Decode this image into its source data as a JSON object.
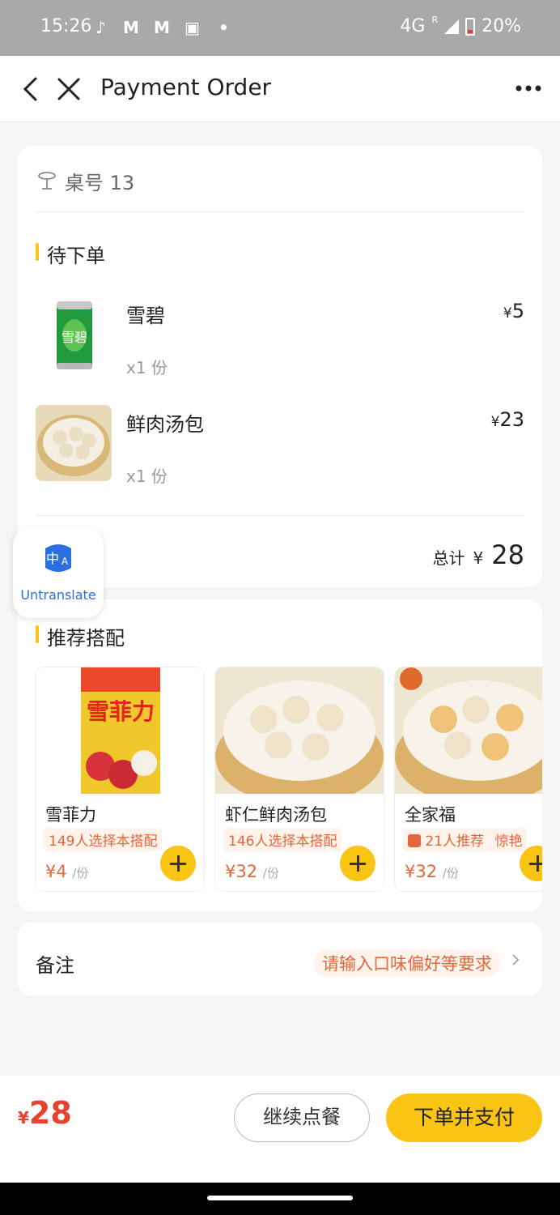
{
  "status_bar": {
    "time": "15:26",
    "network": "4G",
    "roaming": "R",
    "battery": "20%",
    "notification_icons": [
      "tiktok-icon",
      "gmail-icon",
      "gmail-icon",
      "cast-icon",
      "dot-icon"
    ]
  },
  "nav": {
    "title": "Payment Order"
  },
  "order": {
    "table_label": "桌号 13",
    "pending_title": "待下单",
    "currency": "¥",
    "items": [
      {
        "name": "雪碧",
        "qty": "x1 份",
        "price": "5"
      },
      {
        "name": "鲜肉汤包",
        "qty": "x1 份",
        "price": "23"
      }
    ],
    "total_label": "总计",
    "total_value": "28"
  },
  "recommend": {
    "title": "推荐搭配",
    "unit": "/份",
    "items": [
      {
        "name": "雪菲力",
        "tag": "149人选择本搭配",
        "price": "¥4"
      },
      {
        "name": "虾仁鲜肉汤包",
        "tag": "146人选择本搭配",
        "price": "¥32"
      },
      {
        "name": "全家福",
        "tag": "21人推荐",
        "tag2": "惊艳",
        "price": "¥32"
      }
    ]
  },
  "note": {
    "label": "备注",
    "placeholder": "请输入口味偏好等要求"
  },
  "footer": {
    "currency": "¥",
    "total": "28",
    "continue_label": "继续点餐",
    "pay_label": "下单并支付"
  },
  "overlay": {
    "untranslate_label": "Untranslate"
  },
  "colors": {
    "accent": "#f9c414",
    "price_red": "#e8412c",
    "tag_orange": "#e2673a",
    "status_bar": "#a9a9a9"
  }
}
